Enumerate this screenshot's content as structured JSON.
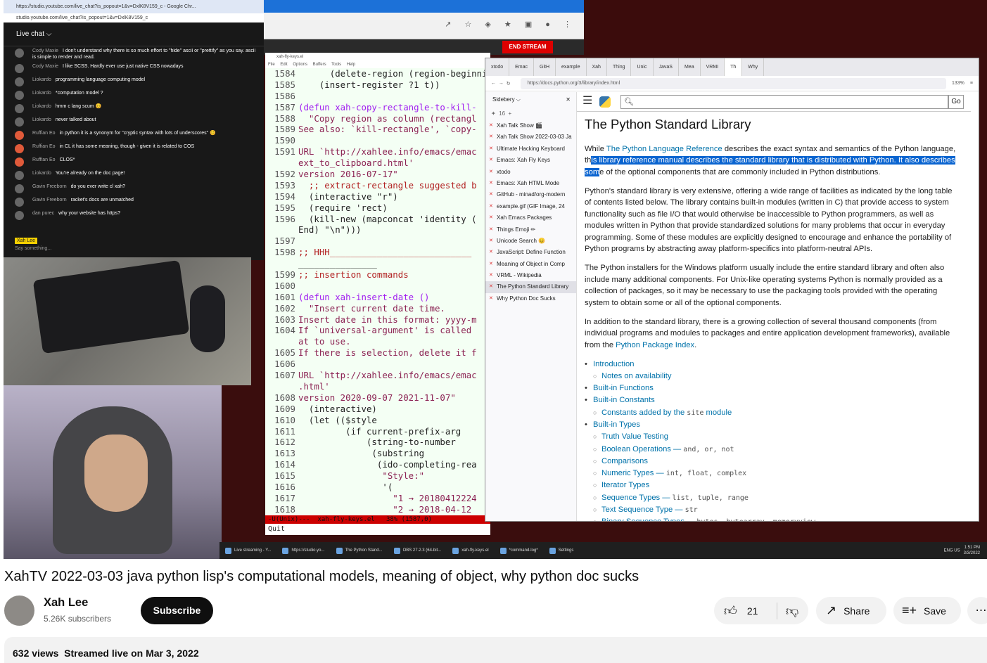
{
  "chat": {
    "title_bar": "https://studio.youtube.com/live_chat?is_popout=1&v=DxlK8V159_c - Google Chr...",
    "address": "studio.youtube.com/live_chat?is_popout=1&v=DxlK8V159_c",
    "header": "Live chat",
    "messages": [
      {
        "author": "Cody Maxie",
        "text": "I don't understand why there is so much effort to \"hide\" ascii or \"prettify\" as you say. ascii is simple to render and read.",
        "avatar": "grey"
      },
      {
        "author": "Cody Maxie",
        "text": "I like SCSS. Hardly ever use just native CSS nowadays",
        "avatar": "grey"
      },
      {
        "author": "Liokardo",
        "text": "programming language computing model",
        "avatar": "grey"
      },
      {
        "author": "Liokardo",
        "text": "*computation model ?",
        "avatar": "grey"
      },
      {
        "author": "Liokardo",
        "text": "hmm c lang scum 😊",
        "avatar": "grey"
      },
      {
        "author": "Liokardo",
        "text": "never talked about",
        "avatar": "grey"
      },
      {
        "author": "Ruffian Eo",
        "text": "in python it is a synonym for \"cryptic syntax with lots of underscores\" 😊",
        "avatar": "red"
      },
      {
        "author": "Ruffian Eo",
        "text": "in CL it has some meaning, though - given it is related to COS",
        "avatar": "red"
      },
      {
        "author": "Ruffian Eo",
        "text": "CLOS*",
        "avatar": "red"
      },
      {
        "author": "Liokardo",
        "text": "You're already on the doc page!",
        "avatar": "grey"
      },
      {
        "author": "Gavin Freeborn",
        "text": "do you ever write cl xah?",
        "avatar": "grey"
      },
      {
        "author": "Gavin Freeborn",
        "text": "racket's docs are unmatched",
        "avatar": "grey"
      },
      {
        "author": "dan purec",
        "text": "why your website has https?",
        "avatar": "grey"
      }
    ],
    "me": "Xah Lee",
    "placeholder": "Say something..."
  },
  "stream": {
    "end_label": "END STREAM"
  },
  "emacs": {
    "title": "xah-fly-keys.el",
    "menu": "File Edit Options Buffers Tools Help",
    "lines": [
      {
        "n": "1584",
        "c": "      (delete-region (region-beginni"
      },
      {
        "n": "1585",
        "c": "    (insert-register ?1 t))"
      },
      {
        "n": "1586",
        "c": ""
      },
      {
        "n": "1587",
        "c": "(defun xah-copy-rectangle-to-kill-"
      },
      {
        "n": "1588",
        "c": "  \"Copy region as column (rectangl"
      },
      {
        "n": "1589",
        "c": "See also: `kill-rectangle', `copy-"
      },
      {
        "n": "1590",
        "c": ""
      },
      {
        "n": "1591",
        "c": "URL `http://xahlee.info/emacs/emac"
      },
      {
        "n": "",
        "c": "ext_to_clipboard.html'"
      },
      {
        "n": "1592",
        "c": "version 2016-07-17\""
      },
      {
        "n": "1593",
        "c": "  ;; extract-rectangle suggested b"
      },
      {
        "n": "1594",
        "c": "  (interactive \"r\")"
      },
      {
        "n": "1595",
        "c": "  (require 'rect)"
      },
      {
        "n": "1596",
        "c": "  (kill-new (mapconcat 'identity ("
      },
      {
        "n": "",
        "c": "End) \"\\n\")))"
      },
      {
        "n": "1597",
        "c": ""
      },
      {
        "n": "1598",
        "c": ";; HHH___________________________"
      },
      {
        "n": "",
        "c": "_______________"
      },
      {
        "n": "1599",
        "c": ";; insertion commands"
      },
      {
        "n": "1600",
        "c": ""
      },
      {
        "n": "1601",
        "c": "(defun xah-insert-date ()"
      },
      {
        "n": "1602",
        "c": "  \"Insert current date time."
      },
      {
        "n": "1603",
        "c": "Insert date in this format: yyyy-m"
      },
      {
        "n": "1604",
        "c": "If `universal-argument' is called"
      },
      {
        "n": "",
        "c": "at to use."
      },
      {
        "n": "1605",
        "c": "If there is selection, delete it f"
      },
      {
        "n": "1606",
        "c": ""
      },
      {
        "n": "1607",
        "c": "URL `http://xahlee.info/emacs/emac"
      },
      {
        "n": "",
        "c": ".html'"
      },
      {
        "n": "1608",
        "c": "version 2020-09-07 2021-11-07\""
      },
      {
        "n": "1609",
        "c": "  (interactive)"
      },
      {
        "n": "1610",
        "c": "  (let (($style"
      },
      {
        "n": "1611",
        "c": "         (if current-prefix-arg"
      },
      {
        "n": "1612",
        "c": "             (string-to-number"
      },
      {
        "n": "1613",
        "c": "              (substring"
      },
      {
        "n": "1614",
        "c": "               (ido-completing-rea"
      },
      {
        "n": "1615",
        "c": "                \"Style:\""
      },
      {
        "n": "1616",
        "c": "                '("
      },
      {
        "n": "1617",
        "c": "                  \"1 → 20180412224"
      },
      {
        "n": "1618",
        "c": "                  \"2 → 2018-04-12"
      }
    ],
    "modeline": "-U(Unix)---  xah-fly-keys.el   38% (1587,0)",
    "minibuffer": "Quit"
  },
  "firefox": {
    "tabs": [
      "xtodo",
      "Emac",
      "GitH",
      "example",
      "Xah",
      "Thing",
      "Unic",
      "JavaS",
      "Mea",
      "VRMI",
      "Th",
      "Why"
    ],
    "url": "https://docs.python.org/3/library/index.html",
    "zoom": "133%",
    "sidebar": {
      "title": "Sidebery",
      "count": "16",
      "items": [
        "Xah Talk Show 🎬",
        "Xah Talk Show 2022-03-03 Ja",
        "Ultimate Hacking Keyboard",
        "Emacs: Xah Fly Keys",
        "xtodo",
        "Emacs: Xah HTML Mode",
        "GitHub - minad/org-modern",
        "example.gif (GIF Image, 24",
        "Xah Emacs Packages",
        "Things Emoji ✏",
        "Unicode Search 😊",
        "JavaScript: Define Function",
        "Meaning of Object in Comp",
        "VRML - Wikipedia",
        "The Python Standard Library",
        "Why Python Doc Sucks"
      ],
      "selected": 14
    },
    "doc": {
      "go": "Go",
      "title": "The Python Standard Library",
      "p1_a": "While ",
      "p1_link": "The Python Language Reference",
      "p1_b": " describes the exact syntax and semantics of the Python language, th",
      "p1_hl": "is library reference manual describes the standard library that is distributed with Python. It also describes som",
      "p1_c": "e of the optional components that are commonly included in Python distributions.",
      "p2": "Python's standard library is very extensive, offering a wide range of facilities as indicated by the long table of contents listed below. The library contains built-in modules (written in C) that provide access to system functionality such as file I/O that would otherwise be inaccessible to Python programmers, as well as modules written in Python that provide standardized solutions for many problems that occur in everyday programming. Some of these modules are explicitly designed to encourage and enhance the portability of Python programs by abstracting away platform-specifics into platform-neutral APIs.",
      "p3": "The Python installers for the Windows platform usually include the entire standard library and often also include many additional components. For Unix-like operating systems Python is normally provided as a collection of packages, so it may be necessary to use the packaging tools provided with the operating system to obtain some or all of the optional components.",
      "p4_a": "In addition to the standard library, there is a growing collection of several thousand components (from individual programs and modules to packages and entire application development frameworks), available from the ",
      "p4_link": "Python Package Index",
      "p4_b": ".",
      "toc": [
        {
          "text": "Introduction",
          "sub": false,
          "code": ""
        },
        {
          "text": "Notes on availability",
          "sub": true,
          "code": ""
        },
        {
          "text": "Built-in Functions",
          "sub": false,
          "code": ""
        },
        {
          "text": "Built-in Constants",
          "sub": false,
          "code": ""
        },
        {
          "text": "Constants added by the ",
          "sub": true,
          "code": "site",
          "after": " module"
        },
        {
          "text": "Built-in Types",
          "sub": false,
          "code": ""
        },
        {
          "text": "Truth Value Testing",
          "sub": true,
          "code": ""
        },
        {
          "text": "Boolean Operations — ",
          "sub": true,
          "code": "and, or, not"
        },
        {
          "text": "Comparisons",
          "sub": true,
          "code": ""
        },
        {
          "text": "Numeric Types — ",
          "sub": true,
          "code": "int, float, complex"
        },
        {
          "text": "Iterator Types",
          "sub": true,
          "code": ""
        },
        {
          "text": "Sequence Types — ",
          "sub": true,
          "code": "list, tuple, range"
        },
        {
          "text": "Text Sequence Type — ",
          "sub": true,
          "code": "str"
        },
        {
          "text": "Binary Sequence Types — ",
          "sub": true,
          "code": "bytes, bytearray, memoryview"
        }
      ]
    }
  },
  "taskbar": {
    "items": [
      "Live streaming - Y...",
      "https://studio.yo...",
      "The Python Stand...",
      "OBS 27.2.3 (64-bit...",
      "xah-fly-keys.el",
      "*command-log*",
      "Settings"
    ],
    "lang": "ENG US",
    "time": "1:51 PM",
    "date": "3/3/2022"
  },
  "video": {
    "title": "XahTV 2022-03-03 java python lisp's computational models, meaning of object, why python doc sucks",
    "channel": "Xah Lee",
    "subscribers": "5.26K subscribers",
    "subscribe": "Subscribe",
    "likes": "21",
    "share": "Share",
    "save": "Save",
    "views": "632 views",
    "streamed": "Streamed live on Mar 3, 2022"
  },
  "colors": {
    "accent": "#0a64d0",
    "link": "#0072aa",
    "subscribe_bg": "#0f0f0f",
    "end_stream": "#dd0000"
  }
}
